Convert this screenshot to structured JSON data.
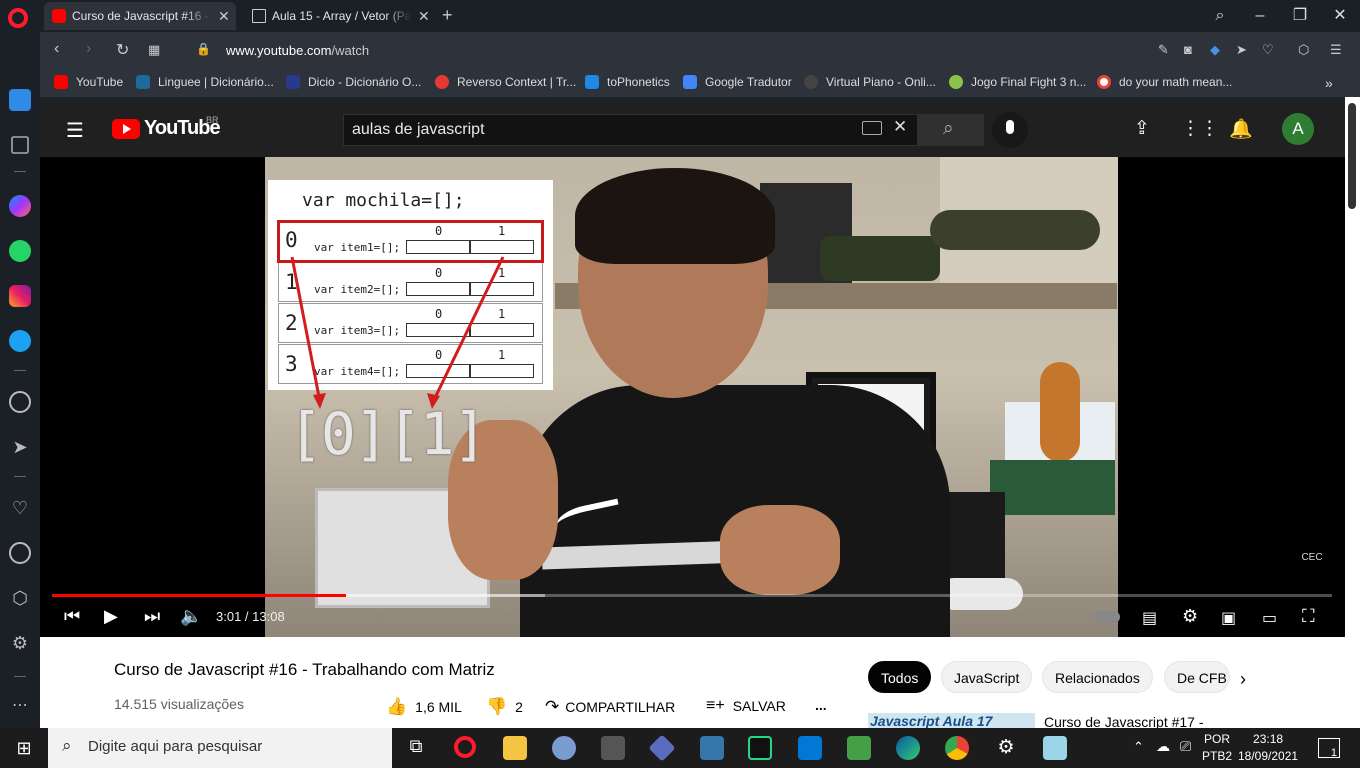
{
  "browser": {
    "tabs": [
      {
        "label": "Curso de Javascript #16 - Trabalhando com Matriz",
        "active": true
      },
      {
        "label": "Aula 15 - Array / Vetor (Parte 2)",
        "active": false
      }
    ],
    "url_domain": "www.youtube.com",
    "url_path": "/watch",
    "new_tab": "+",
    "bookmarks": [
      {
        "label": "YouTube",
        "color": "#ff0000"
      },
      {
        "label": "Linguee | Dicionário...",
        "color": "#1c6b9c"
      },
      {
        "label": "Dicio - Dicionário O...",
        "color": "#283a8c"
      },
      {
        "label": "Reverso Context | Tr...",
        "color": "#e53935"
      },
      {
        "label": "toPhonetics",
        "color": "#1e88e5"
      },
      {
        "label": "Google Tradutor",
        "color": "#4285f4"
      },
      {
        "label": "Virtual Piano - Onli...",
        "color": "#444444"
      },
      {
        "label": "Jogo Final Fight 3 n...",
        "color": "#8bc34a"
      },
      {
        "label": "do your math mean...",
        "color": "#ea4335"
      }
    ],
    "bookmarks_more": "»"
  },
  "youtube": {
    "logo_text": "YouTube",
    "logo_region": "BR",
    "search_value": "aulas de javascript",
    "avatar_letter": "A",
    "video": {
      "slide_title": "var mochila=[];",
      "rows": [
        {
          "index": "0",
          "code": "var item1=[];",
          "c0": "0",
          "c1": "1"
        },
        {
          "index": "1",
          "code": "var item2=[];",
          "c0": "0",
          "c1": "1"
        },
        {
          "index": "2",
          "code": "var item3=[];",
          "c0": "0",
          "c1": "1"
        },
        {
          "index": "3",
          "code": "var item4=[];",
          "c0": "0",
          "c1": "1"
        }
      ],
      "big_index": "[0][1]",
      "watermark": "CEC",
      "progress_fraction": 0.23,
      "buffered_fraction": 0.385,
      "current_time": "3:01",
      "duration": "13:08",
      "time_separator": " / "
    },
    "title": "Curso de Javascript #16 - Trabalhando com Matriz",
    "views": "14.515 visualizações",
    "likes": "1,6 MIL",
    "dislikes": "2",
    "share_label": "COMPARTILHAR",
    "save_label": "SALVAR",
    "more_label": "...",
    "chips": [
      "Todos",
      "JavaScript",
      "Relacionados",
      "De CFB"
    ],
    "rec_thumb_text": "Javascript Aula 17",
    "rec_title": "Curso de Javascript #17 -"
  },
  "taskbar": {
    "search_placeholder": "Digite aqui para pesquisar",
    "lang_top": "POR",
    "lang_bottom": "PTB2",
    "time": "23:18",
    "date": "18/09/2021",
    "notif_count": "1"
  }
}
